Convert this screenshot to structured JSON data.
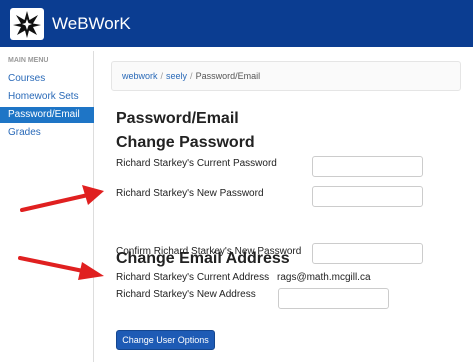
{
  "app": {
    "name": "WeBWorK"
  },
  "sidebar": {
    "title": "MAIN MENU",
    "items": [
      {
        "label": "Courses"
      },
      {
        "label": "Homework Sets"
      },
      {
        "label": "Password/Email",
        "active": true
      },
      {
        "label": "Grades"
      }
    ]
  },
  "breadcrumb": {
    "items": [
      "webwork",
      "seely",
      "Password/Email"
    ]
  },
  "page": {
    "title": "Password/Email"
  },
  "password_section": {
    "title": "Change Password",
    "current_label": "Richard Starkey's Current Password",
    "new_label": "Richard Starkey's New Password",
    "confirm_label": "Confirm Richard Starkey's New Password"
  },
  "email_section": {
    "title": "Change Email Address",
    "current_label": "Richard Starkey's Current Address",
    "current_value": "rags@math.mcgill.ca",
    "new_label": "Richard Starkey's New Address"
  },
  "submit": {
    "label": "Change User Options"
  },
  "colors": {
    "topbar": "#0b3d91",
    "accent": "#1e75c6",
    "arrow": "#e02020",
    "link": "#2a6ab8"
  },
  "icons": {
    "logo": "star-burst-icon",
    "annotation": "red-arrow-icon"
  }
}
